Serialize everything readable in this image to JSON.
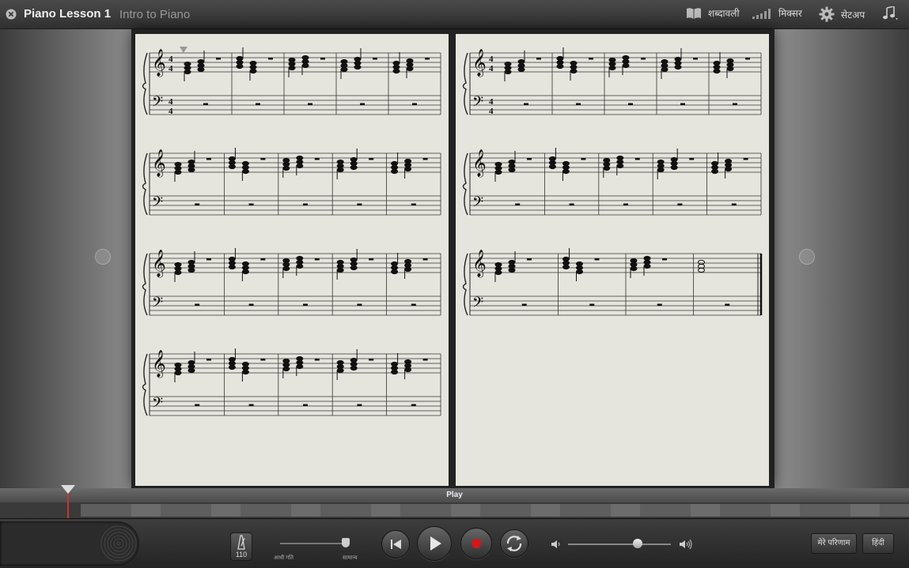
{
  "header": {
    "title": "Piano Lesson 1",
    "subtitle": "Intro to Piano",
    "glossary_label": "शब्दावली",
    "mixer_label": "मिक्सर",
    "setup_label": "सेटअप"
  },
  "icons": {
    "close": "close-icon",
    "glossary": "book-icon",
    "mixer": "mixer-icon",
    "setup": "gear-icon",
    "notes_menu": "music-note-icon",
    "prev_page": "left-arrow-icon",
    "next_page": "right-arrow-icon",
    "metronome": "metronome-icon",
    "volume_low": "speaker-low-icon",
    "volume_high": "speaker-high-icon"
  },
  "score": {
    "left_page_systems": 4,
    "right_page_systems": 3,
    "measures_per_system": 5,
    "time_signature": "4/4"
  },
  "transport": {
    "play_label": "Play",
    "tempo": "110",
    "speed_slow_label": "आधी गति",
    "speed_normal_label": "सामान्य",
    "my_results_label": "मेरे परिणाम",
    "language_label": "हिंदी"
  },
  "playback": {
    "volume_level": 0.65,
    "speed_level": 1.0
  },
  "colors": {
    "paper": "#e6e5dd",
    "record": "#d21818",
    "playhead": "#cc3333"
  }
}
